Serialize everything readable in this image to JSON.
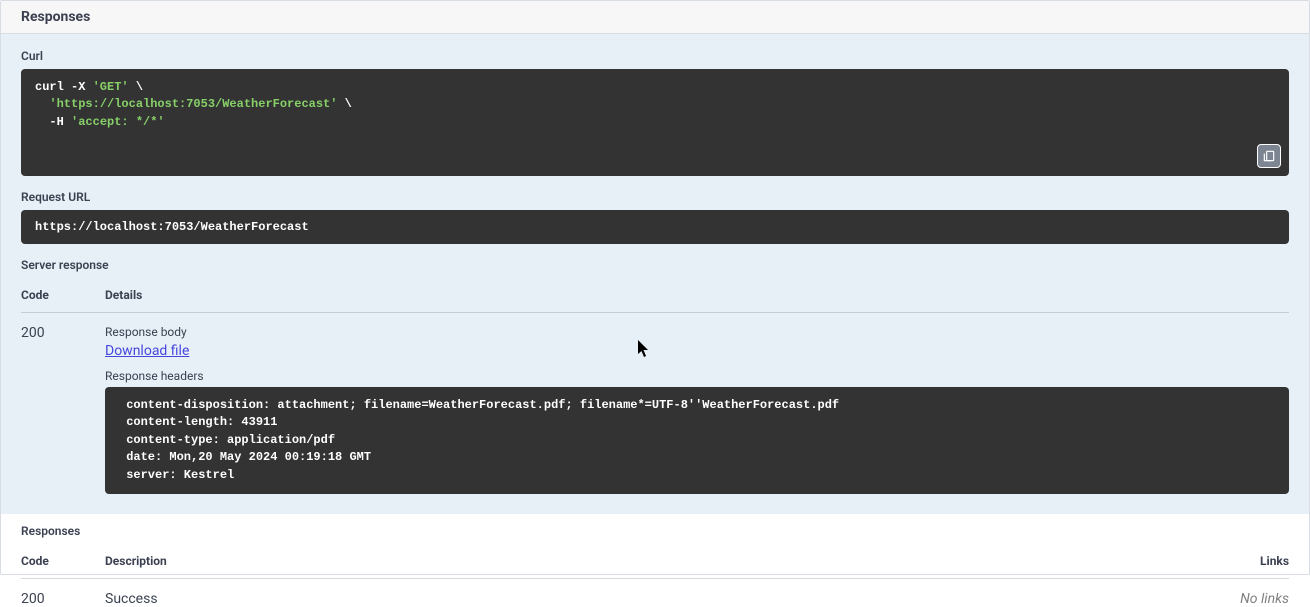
{
  "header": {
    "title": "Responses"
  },
  "curl": {
    "label": "Curl",
    "line1_a": "curl -X ",
    "line1_b": "'GET'",
    "line1_c": " \\",
    "line2_a": "  ",
    "line2_b": "'https://localhost:7053/WeatherForecast'",
    "line2_c": " \\",
    "line3_a": "  -H ",
    "line3_b": "'accept: */*'"
  },
  "request_url": {
    "label": "Request URL",
    "value": "https://localhost:7053/WeatherForecast"
  },
  "server_response": {
    "label": "Server response"
  },
  "live_table": {
    "head_code": "Code",
    "head_details": "Details",
    "row": {
      "code": "200",
      "body_label": "Response body",
      "download_label": "Download file",
      "headers_label": "Response headers",
      "headers_text": " content-disposition: attachment; filename=WeatherForecast.pdf; filename*=UTF-8''WeatherForecast.pdf \n content-length: 43911 \n content-type: application/pdf \n date: Mon,20 May 2024 00:19:18 GMT \n server: Kestrel "
    }
  },
  "doc_responses": {
    "label": "Responses",
    "head_code": "Code",
    "head_desc": "Description",
    "head_links": "Links",
    "row": {
      "code": "200",
      "desc": "Success",
      "links": "No links"
    }
  }
}
